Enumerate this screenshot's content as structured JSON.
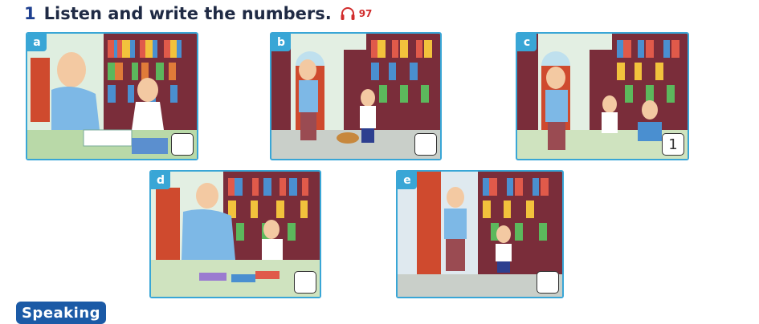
{
  "exercise": {
    "number": "1",
    "title": "Listen and write the numbers.",
    "audio_track": "97"
  },
  "panels": [
    {
      "letter": "a",
      "answer": ""
    },
    {
      "letter": "b",
      "answer": ""
    },
    {
      "letter": "c",
      "answer": "1"
    },
    {
      "letter": "d",
      "answer": ""
    },
    {
      "letter": "e",
      "answer": ""
    }
  ],
  "section_label": "Speaking",
  "colors": {
    "panel_border": "#39a6d6",
    "speaking_bg": "#1b5aa6",
    "audio_icon": "#d12c2c"
  }
}
